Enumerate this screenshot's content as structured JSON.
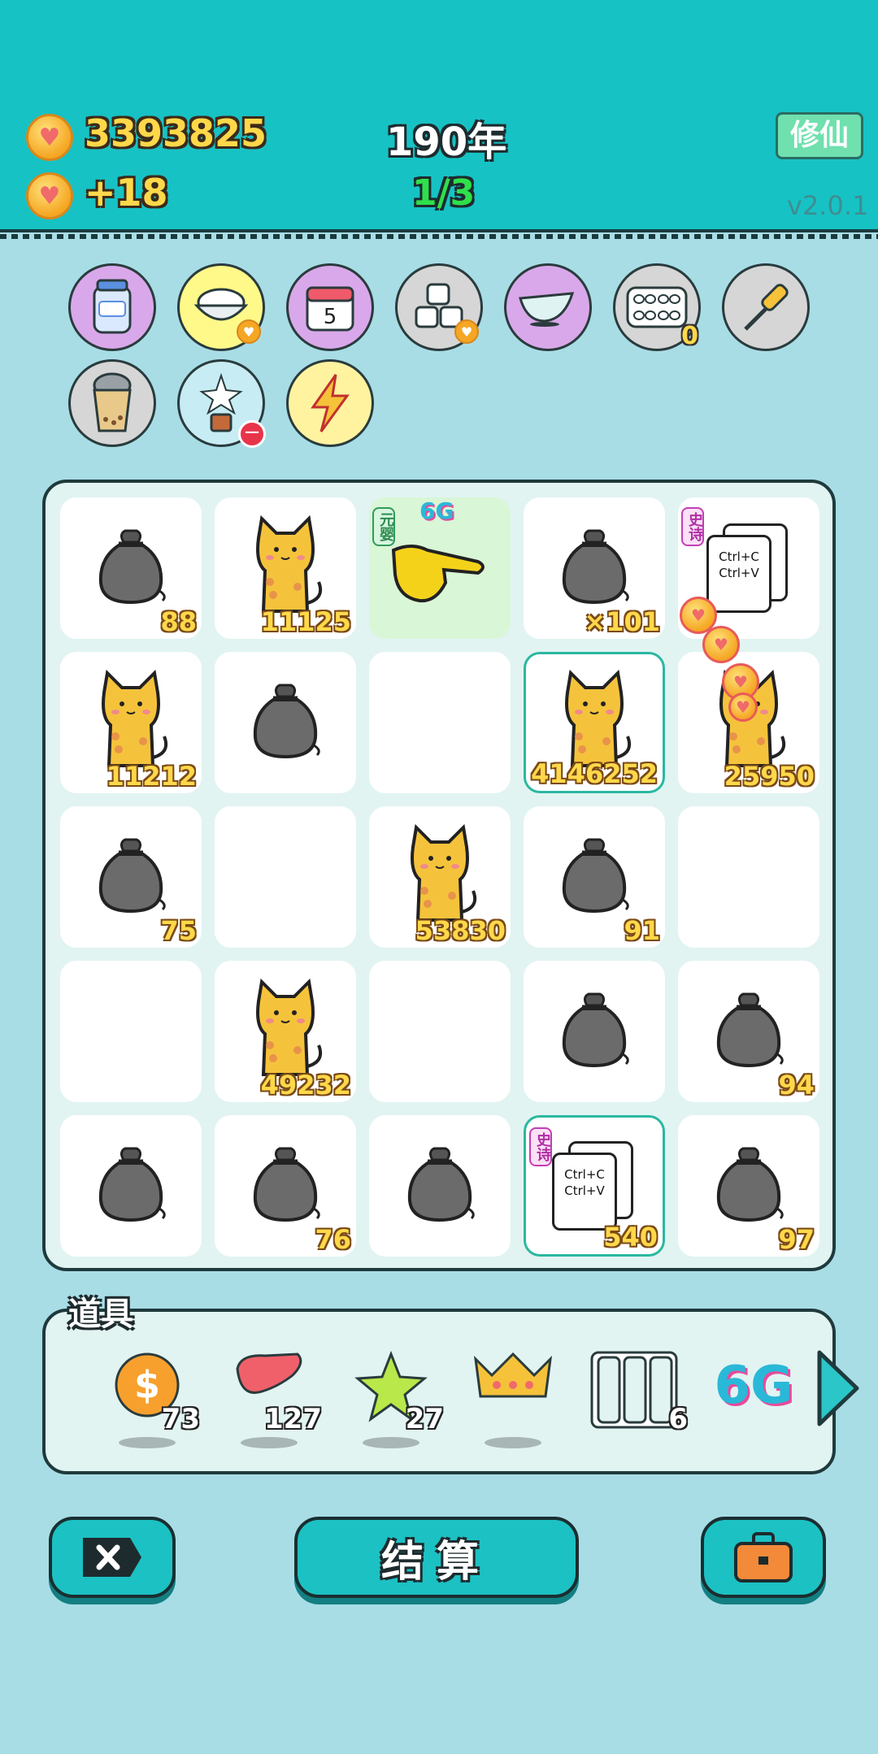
{
  "header": {
    "coins": "3393825",
    "income": "+18",
    "year": "190年",
    "turn": "1/3",
    "xiuxian_label": "修仙",
    "version": "v2.0.1"
  },
  "buffs": [
    {
      "name": "jar-icon"
    },
    {
      "name": "rice-bowl-icon"
    },
    {
      "name": "calendar-icon",
      "text": "5"
    },
    {
      "name": "sugar-cubes-icon"
    },
    {
      "name": "gravy-boat-icon"
    },
    {
      "name": "egg-tray-icon",
      "count": "0"
    },
    {
      "name": "screwdriver-icon"
    },
    {
      "name": "bubble-tea-icon"
    },
    {
      "name": "lily-plant-icon"
    },
    {
      "name": "lightning-icon"
    }
  ],
  "calendar_day": "5",
  "egg_tray_count": "0",
  "board": {
    "cells": [
      {
        "type": "bag",
        "value": "88"
      },
      {
        "type": "cat",
        "value": "11125"
      },
      {
        "type": "hand",
        "tag": "元婴",
        "top_label": "6G",
        "value": ""
      },
      {
        "type": "bag",
        "value": "×101"
      },
      {
        "type": "copy",
        "tag": "史诗",
        "value": ""
      },
      {
        "type": "cat",
        "value": "11212"
      },
      {
        "type": "bag",
        "value": ""
      },
      {
        "type": "empty",
        "value": ""
      },
      {
        "type": "cat",
        "value": "4146252",
        "highlight": true
      },
      {
        "type": "cat",
        "value": "25950"
      },
      {
        "type": "bag",
        "value": "75"
      },
      {
        "type": "empty",
        "value": ""
      },
      {
        "type": "cat",
        "value": "53830"
      },
      {
        "type": "bag",
        "value": "91"
      },
      {
        "type": "empty",
        "value": ""
      },
      {
        "type": "empty",
        "value": ""
      },
      {
        "type": "cat",
        "value": "49232"
      },
      {
        "type": "empty",
        "value": ""
      },
      {
        "type": "bag",
        "value": ""
      },
      {
        "type": "bag",
        "value": "94"
      },
      {
        "type": "bag",
        "value": ""
      },
      {
        "type": "bag",
        "value": "76"
      },
      {
        "type": "bag",
        "value": ""
      },
      {
        "type": "copy",
        "tag": "史诗",
        "value": "540",
        "highlight": true
      },
      {
        "type": "bag",
        "value": "97"
      }
    ],
    "copy_text_1": "Ctrl+C",
    "copy_text_2": "Ctrl+V"
  },
  "items": {
    "title": "道具",
    "list": [
      {
        "name": "dollar-coin-icon",
        "qty": "73"
      },
      {
        "name": "liver-icon",
        "qty": "127"
      },
      {
        "name": "star-icon",
        "qty": "27"
      },
      {
        "name": "crown-icon",
        "qty": ""
      },
      {
        "name": "panels-icon",
        "qty": "6"
      },
      {
        "name": "6g-icon",
        "qty": "",
        "text": "6G"
      }
    ]
  },
  "bottom": {
    "settle_label": "结算"
  },
  "colors": {
    "header_bg": "#17c2c4",
    "page_bg": "#a8dde6",
    "accent_gold": "#ffd84a",
    "turn_green": "#2ee04a"
  }
}
